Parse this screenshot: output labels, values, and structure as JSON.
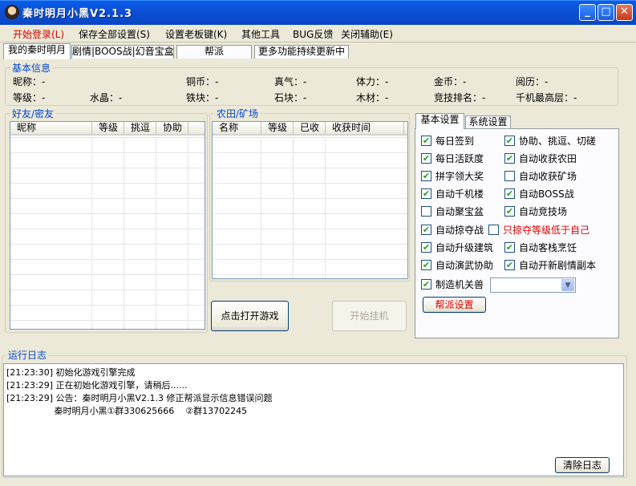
{
  "window": {
    "title": "秦时明月小黑V2.1.3",
    "min_label": "_",
    "max_label": "□",
    "close_label": "✕"
  },
  "menu": [
    {
      "label": "开始登录(L)",
      "active": true
    },
    {
      "label": "保存全部设置(S)"
    },
    {
      "label": "设置老板键(K)"
    },
    {
      "label": "其他工具"
    },
    {
      "label": "BUG反馈"
    },
    {
      "label": "关闭辅助(E)"
    }
  ],
  "tabs": [
    "我的秦时明月",
    "剧情|BOOS战|幻音宝盒",
    "帮派",
    "更多功能持续更新中"
  ],
  "basic_info": {
    "title": "基本信息",
    "row1": [
      "昵称：-",
      "铜币：-",
      "真气：-",
      "体力：-",
      "金币：-",
      "阅历：-"
    ],
    "row2": [
      "等级：-",
      "水晶：-",
      "铁块：-",
      "石块：-",
      "木材：-",
      "竞技排名：-",
      "千机最高层：-"
    ]
  },
  "friends": {
    "title": "好友/密友",
    "columns": [
      "昵称",
      "等级",
      "挑逗",
      "协助"
    ]
  },
  "farm": {
    "title": "农田/矿场",
    "columns": [
      "名称",
      "等级",
      "已收",
      "收获时间"
    ]
  },
  "buttons": {
    "open_game": "点击打开游戏",
    "start_hangup": "开始挂机",
    "guild_settings": "帮派设置",
    "clear_log": "清除日志"
  },
  "settings_tabs": [
    "基本设置",
    "系统设置"
  ],
  "settings": [
    {
      "label": "每日签到",
      "checked": true
    },
    {
      "label": "协助、挑逗、切磋",
      "checked": true
    },
    {
      "label": "每日活跃度",
      "checked": true
    },
    {
      "label": "自动收获农田",
      "checked": true
    },
    {
      "label": "拼字领大奖",
      "checked": true
    },
    {
      "label": "自动收获矿场",
      "checked": false
    },
    {
      "label": "自动千机楼",
      "checked": true
    },
    {
      "label": "自动BOSS战",
      "checked": true
    },
    {
      "label": "自动聚宝盆",
      "checked": false
    },
    {
      "label": "自动竞技场",
      "checked": true
    },
    {
      "label": "自动掠夺战",
      "checked": true
    },
    {
      "label": "只掠夺等级低于自己",
      "checked": false
    },
    {
      "label": "自动升级建筑",
      "checked": true
    },
    {
      "label": "自动客栈烹饪",
      "checked": true
    },
    {
      "label": "自动演武协助",
      "checked": true
    },
    {
      "label": "自动开新剧情副本",
      "checked": true
    },
    {
      "label": "制造机关兽",
      "checked": true
    }
  ],
  "log": {
    "title": "运行日志",
    "lines": [
      "[21:23:30] 初始化游戏引擎完成",
      "[21:23:29] 正在初始化游戏引擎，请稍后......",
      "[21:23:29] 公告：秦时明月小黑V2.1.3 修正帮派显示信息错误问题",
      "                 秦时明月小黑①群330625666    ②群13702245"
    ]
  },
  "colors": {
    "titlebar": "#0b4fd6",
    "accent_red": "#e00000",
    "group_title": "#0046d5",
    "face": "#ece9d8"
  }
}
